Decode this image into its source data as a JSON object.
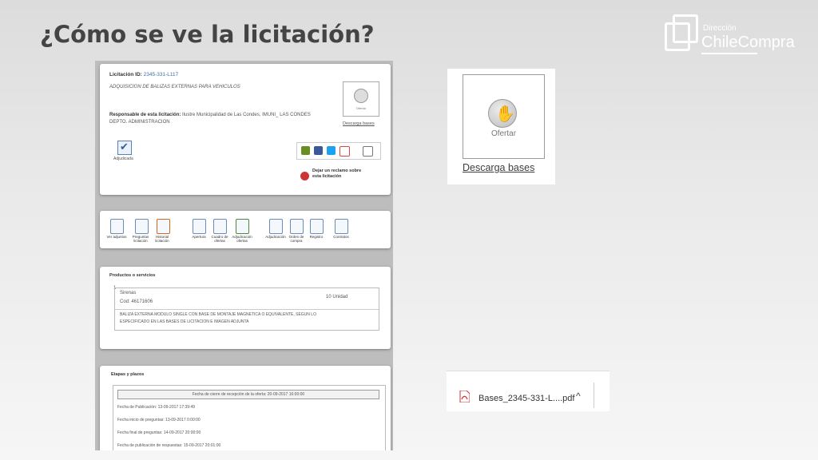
{
  "slide": {
    "title": "¿Cómo se ve la licitación?"
  },
  "logo": {
    "line1": "Dirección",
    "line2": "ChileCompra"
  },
  "licitacion": {
    "id_label": "Licitación ID:",
    "id_value": "2345-331-L117",
    "description": "ADQUISICION DE BALIZAS EXTERNAS PARA VEHICULOS",
    "responsable_label": "Responsable de esta licitación:",
    "responsable_value": "Ilustre Municipalidad de Las Condes, IMUNI_ LAS CONDES",
    "department": "DEPTO. ADMINISTRACION",
    "status_label": "Adjudicada",
    "ofertar_label": "Ofertar",
    "descarga_label": "Descarga bases",
    "reclamo_label_1": "Dejar un reclamo sobre",
    "reclamo_label_2": "esta licitación"
  },
  "toolbar": {
    "items": [
      {
        "label": "Ver adjuntos",
        "icon": "magnifier-icon"
      },
      {
        "label": "Preguntas licitación",
        "icon": "question-icon"
      },
      {
        "label": "Historial licitación",
        "icon": "history-icon"
      },
      {
        "label": "Apertura",
        "icon": "envelope-icon"
      },
      {
        "label": "Cuadro de ofertas",
        "icon": "table-icon"
      },
      {
        "label": "Adjudicación ofertas",
        "icon": "award-icon"
      },
      {
        "label": "Adjudicación",
        "icon": "acta-icon"
      },
      {
        "label": "Orden de compra",
        "icon": "document-icon"
      },
      {
        "label": "Registro",
        "icon": "register-icon"
      },
      {
        "label": "Contratos",
        "icon": "contract-icon"
      }
    ]
  },
  "productos": {
    "heading": "Productos o servicios",
    "item_number": "1",
    "name": "Sirenas",
    "code": "Cod: 46171606",
    "quantity": "10 Unidad",
    "description_1": "BALIZA EXTERNA MODULO SINGLE CON BASE DE MONTAJE MAGNETICA O EQUIVALENTE, SEGUN LO",
    "description_2": "ESPECIFICADO EN LAS BASES DE LICITACION E IMAGEN ADJUNTA"
  },
  "etapas": {
    "heading": "Etapas y plazos",
    "cierre": "Fecha de cierre de recepción de la oferta: 20-09-2017 16:00:00",
    "rows": [
      "Fecha de Publicación: 13-09-2017 17:39:49",
      "Fecha inicio de preguntas: 13-09-2017 0:00:00",
      "Fecha final de preguntas: 14-09-2017 20:00:00",
      "Fecha de publicación de respuestas: 15-09-2017 20:01:00"
    ]
  },
  "zoom": {
    "ofertar_label": "Ofertar",
    "descarga_label": "Descarga bases"
  },
  "download": {
    "filename": "Bases_2345-331-L....pdf",
    "caret": "^"
  },
  "colors": {
    "title": "#444444",
    "link_blue": "#3b6ea8",
    "pdf_red": "#d32f2f"
  }
}
